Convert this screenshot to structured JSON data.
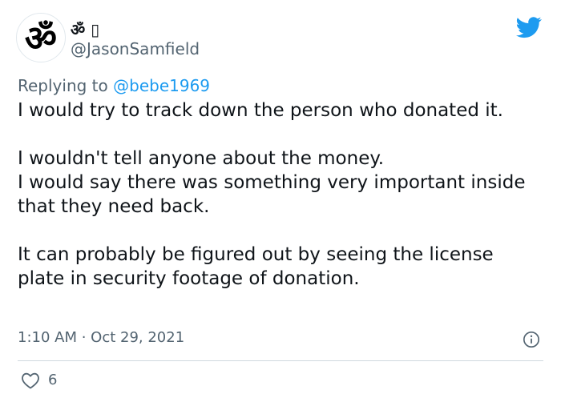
{
  "author": {
    "display_name": "ॐ ▯",
    "handle": "@JasonSamfield",
    "avatar_icon": "om-symbol-icon"
  },
  "brand": {
    "logo_icon": "twitter-bird-icon",
    "color": "#1d9bf0"
  },
  "reply": {
    "prefix": "Replying to",
    "mention": "@bebe1969"
  },
  "tweet": {
    "lines": [
      "I would try to track down the person who donated it.",
      "",
      "I wouldn't tell anyone about the money.",
      "I would say there was something very important inside that they need back.",
      "",
      "It can probably be figured out by seeing the license plate in security footage of donation."
    ]
  },
  "meta": {
    "timestamp": "1:10 AM · Oct 29, 2021",
    "info_icon": "info-icon"
  },
  "actions": {
    "like_icon": "heart-icon",
    "like_count": "6"
  }
}
